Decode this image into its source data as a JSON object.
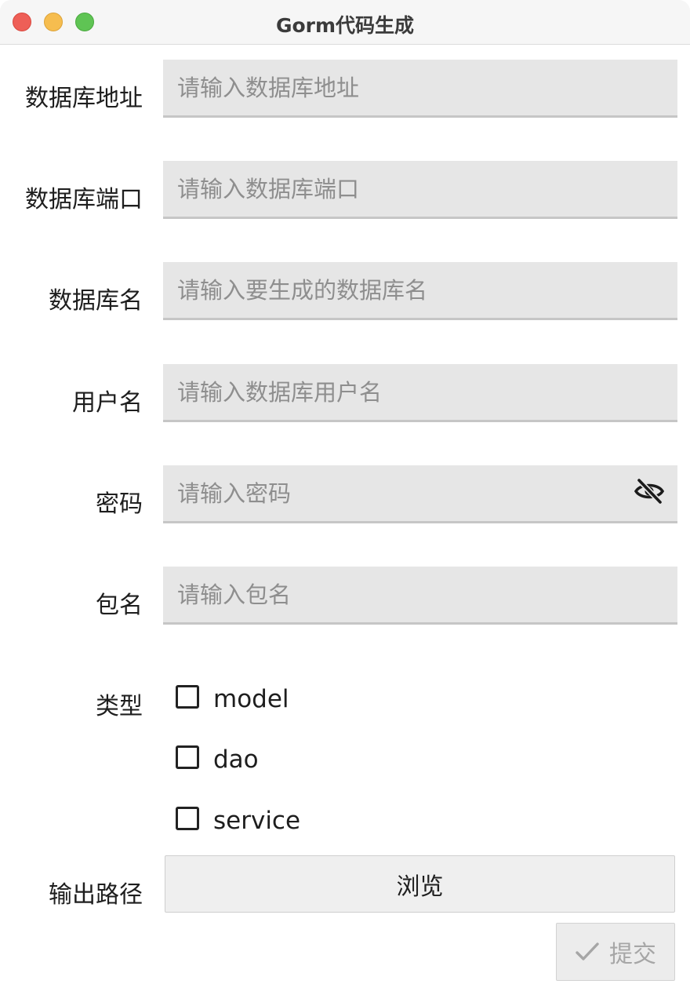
{
  "window": {
    "title": "Gorm代码生成"
  },
  "form": {
    "fields": [
      {
        "label": "数据库地址",
        "placeholder": "请输入数据库地址",
        "value": ""
      },
      {
        "label": "数据库端口",
        "placeholder": "请输入数据库端口",
        "value": ""
      },
      {
        "label": "数据库名",
        "placeholder": "请输入要生成的数据库名",
        "value": ""
      },
      {
        "label": "用户名",
        "placeholder": "请输入数据库用户名",
        "value": ""
      },
      {
        "label": "密码",
        "placeholder": "请输入密码",
        "value": ""
      },
      {
        "label": "包名",
        "placeholder": "请输入包名",
        "value": ""
      }
    ],
    "type": {
      "label": "类型",
      "options": [
        {
          "label": "model",
          "checked": false
        },
        {
          "label": "dao",
          "checked": false
        },
        {
          "label": "service",
          "checked": false
        }
      ]
    },
    "output": {
      "label": "输出路径",
      "browse_label": "浏览"
    },
    "submit": {
      "label": "提交",
      "icon": "check-icon",
      "disabled": true
    }
  },
  "icons": {
    "password_toggle": "eye-off-icon"
  },
  "colors": {
    "field_bg": "#e6e6e6",
    "field_underline": "#c6c6c6",
    "placeholder": "#8e8e8e",
    "close": "#ee5f57",
    "minimize": "#f6bd4f",
    "maximize": "#5fc454"
  }
}
